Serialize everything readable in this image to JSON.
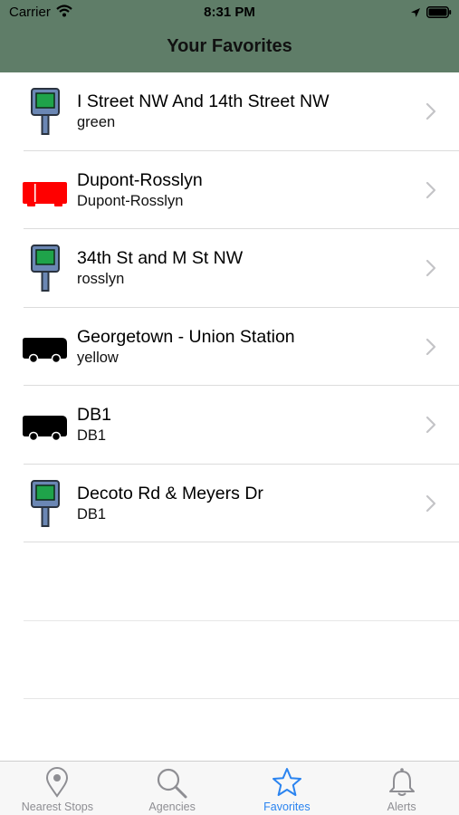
{
  "status_bar": {
    "carrier": "Carrier",
    "time": "8:31 PM"
  },
  "nav": {
    "title": "Your Favorites"
  },
  "favorites": [
    {
      "icon": "bus-stop-sign-icon",
      "title": "I Street NW And 14th Street NW",
      "subtitle": "green"
    },
    {
      "icon": "red-bus-icon",
      "title": "Dupont-Rosslyn",
      "subtitle": "Dupont-Rosslyn"
    },
    {
      "icon": "bus-stop-sign-icon",
      "title": "34th St and M St NW",
      "subtitle": "rosslyn"
    },
    {
      "icon": "bus-icon",
      "title": "Georgetown - Union Station",
      "subtitle": "yellow"
    },
    {
      "icon": "bus-icon",
      "title": "DB1",
      "subtitle": "DB1"
    },
    {
      "icon": "bus-stop-sign-icon",
      "title": "Decoto Rd & Meyers Dr",
      "subtitle": "DB1"
    }
  ],
  "tab_bar": {
    "tabs": [
      {
        "label": "Nearest Stops",
        "icon": "map-pin-icon",
        "active": false
      },
      {
        "label": "Agencies",
        "icon": "search-icon",
        "active": false
      },
      {
        "label": "Favorites",
        "icon": "star-icon",
        "active": true
      },
      {
        "label": "Alerts",
        "icon": "bell-icon",
        "active": false
      }
    ]
  },
  "colors": {
    "nav_background": "#5f7d68",
    "stop_sign_green": "#1fa34a",
    "stop_sign_frame": "#6b87b4",
    "red_bus": "#ff0000",
    "active_tab": "#2b84f0",
    "inactive_tab": "#8e8e93"
  }
}
